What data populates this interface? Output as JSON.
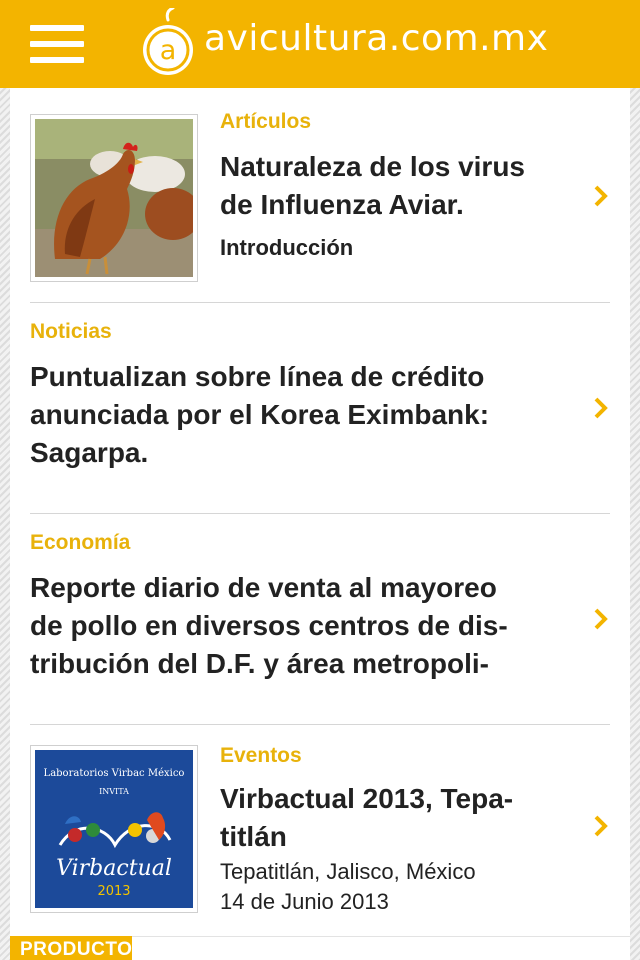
{
  "header": {
    "site_name": "avicultura.com.mx",
    "logo_letter": "a",
    "brand_color": "#f3b400"
  },
  "feed": [
    {
      "category": "Artículos",
      "title_lines": [
        "Naturaleza de los virus",
        "de Influenza Aviar."
      ],
      "subtitle": "Introducción",
      "thumbnail": "hens-photo"
    },
    {
      "category": "Noticias",
      "title_lines": [
        "Puntualizan sobre línea de crédito",
        "anunciada por el Korea Eximbank:",
        "Sagarpa."
      ]
    },
    {
      "category": "Economía",
      "title_lines": [
        "Reporte diario de venta al mayoreo",
        "de pollo en diversos centros de dis-",
        "tribución del D.F. y área metropoli-"
      ]
    },
    {
      "category": "Eventos",
      "title_lines": [
        "Virbactual 2013, Tepa-",
        "titlán"
      ],
      "location": "Tepatitlán, Jalisco, México",
      "date": "14 de Junio 2013",
      "thumbnail": "virbactual-poster",
      "poster": {
        "line1": "Laboratorios Virbac México",
        "line2": "INVITA",
        "brand": "Virbactual",
        "year": "2013"
      }
    }
  ],
  "footer": {
    "tab_label": "PRODUCTOS"
  }
}
